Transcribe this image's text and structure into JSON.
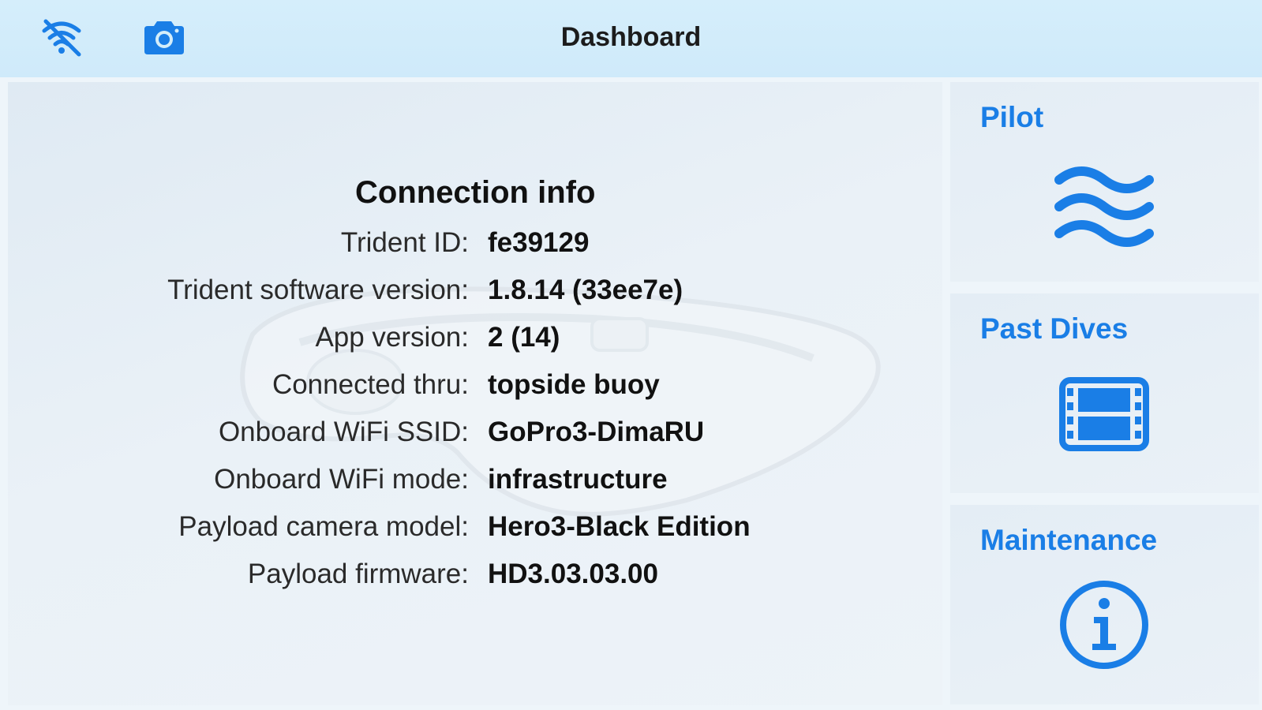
{
  "header": {
    "title": "Dashboard",
    "wifi_icon": "wifi-off-icon",
    "camera_icon": "camera-icon"
  },
  "connection_info": {
    "title": "Connection info",
    "rows": [
      {
        "label": "Trident ID:",
        "value": "fe39129"
      },
      {
        "label": "Trident software version:",
        "value": "1.8.14 (33ee7e)"
      },
      {
        "label": "App version:",
        "value": "2 (14)"
      },
      {
        "label": "Connected thru:",
        "value": "topside buoy"
      },
      {
        "label": "Onboard WiFi SSID:",
        "value": "GoPro3-DimaRU"
      },
      {
        "label": "Onboard WiFi mode:",
        "value": "infrastructure"
      },
      {
        "label": "Payload camera model:",
        "value": "Hero3-Black Edition"
      },
      {
        "label": "Payload firmware:",
        "value": "HD3.03.03.00"
      }
    ]
  },
  "sidebar": {
    "tiles": [
      {
        "label": "Pilot",
        "icon": "waves-icon"
      },
      {
        "label": "Past Dives",
        "icon": "film-icon"
      },
      {
        "label": "Maintenance",
        "icon": "info-icon"
      }
    ]
  },
  "colors": {
    "accent": "#1a7ee6",
    "navbar_bg": "#d3edfa",
    "panel_bg": "#e6eef5"
  }
}
